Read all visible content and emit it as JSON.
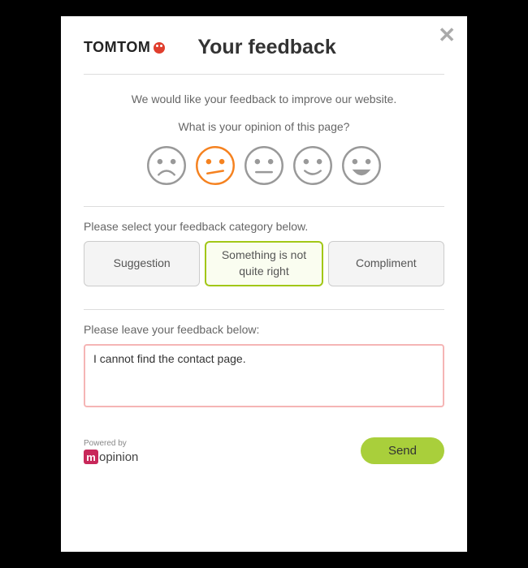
{
  "logo_text": "TOMTOM",
  "title": "Your feedback",
  "intro": "We would like your feedback to improve our website.",
  "question": "What is your opinion of this page?",
  "faces": {
    "selected_index": 1,
    "names": [
      "very-sad",
      "sad",
      "neutral",
      "happy",
      "very-happy"
    ]
  },
  "category_label": "Please select your feedback category below.",
  "categories": [
    {
      "label": "Suggestion",
      "selected": false
    },
    {
      "label": "Something is not quite right",
      "selected": true
    },
    {
      "label": "Compliment",
      "selected": false
    }
  ],
  "feedback_label": "Please leave your feedback below:",
  "feedback_value": "I cannot find the contact page.",
  "powered_by": "Powered by",
  "powered_brand_m": "m",
  "powered_brand_rest": "opinion",
  "send_label": "Send",
  "colors": {
    "accent_green": "#a9cf3b",
    "accent_orange": "#f58220",
    "error_border": "#f5b5b5"
  }
}
